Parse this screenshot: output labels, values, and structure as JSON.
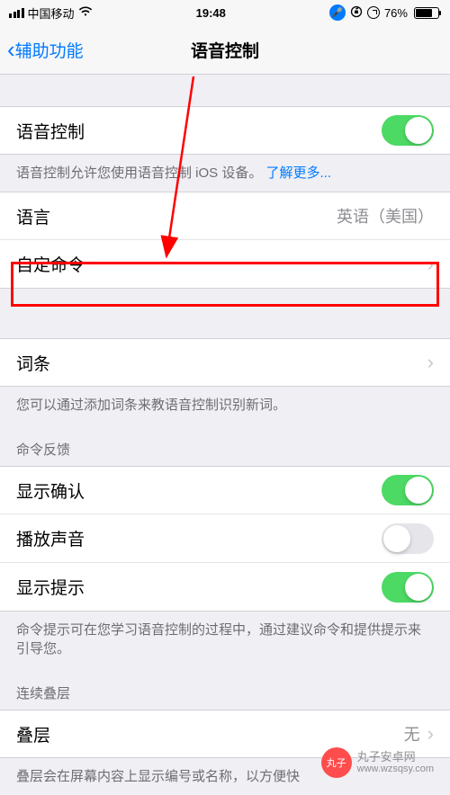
{
  "status": {
    "carrier": "中国移动",
    "time": "19:48",
    "battery": "76%"
  },
  "nav": {
    "back": "辅助功能",
    "title": "语音控制"
  },
  "voiceControl": {
    "label": "语音控制",
    "footer": "语音控制允许您使用语音控制 iOS 设备。",
    "learnMore": "了解更多..."
  },
  "language": {
    "label": "语言",
    "value": "英语（美国）"
  },
  "customCommands": {
    "label": "自定命令"
  },
  "vocabulary": {
    "label": "词条",
    "footer": "您可以通过添加词条来教语音控制识别新词。"
  },
  "feedback": {
    "header": "命令反馈",
    "showConfirm": "显示确认",
    "playSound": "播放声音",
    "showHints": "显示提示",
    "footer": "命令提示可在您学习语音控制的过程中，通过建议命令和提供提示来引导您。"
  },
  "overlay": {
    "header": "连续叠层",
    "label": "叠层",
    "value": "无",
    "footer": "叠层会在屏幕内容上显示编号或名称，以方便快"
  },
  "watermark": {
    "logo": "丸子",
    "name": "丸子安卓网",
    "url": "www.wzsqsy.com"
  }
}
